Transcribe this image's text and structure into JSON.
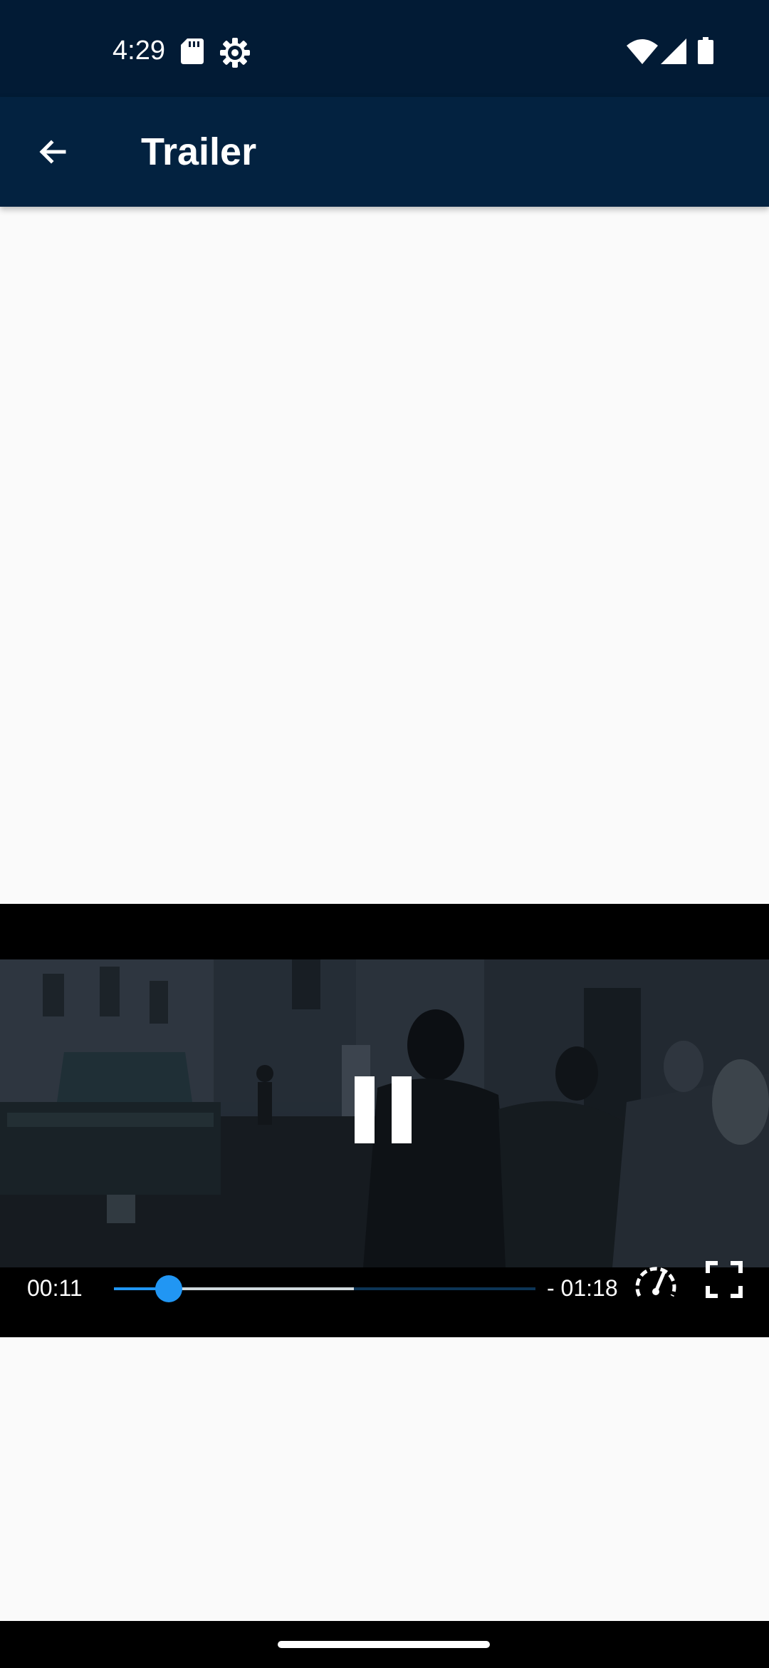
{
  "status_bar": {
    "time": "4:29",
    "icons": [
      "sd-card-icon",
      "settings-gear-icon",
      "wifi-icon",
      "cell-signal-icon",
      "battery-icon"
    ]
  },
  "app_bar": {
    "title": "Trailer",
    "back_icon": "arrow-left-icon",
    "background": "#032240"
  },
  "player": {
    "state": "playing",
    "control_icon": "pause-icon",
    "elapsed": "00:11",
    "remaining": "- 01:18",
    "progress": 0.13,
    "buffered": 0.57,
    "accent": "#2196f3",
    "speed_icon": "playback-speed-icon",
    "fullscreen_icon": "fullscreen-icon"
  },
  "colors": {
    "status_bar": "#021b35",
    "page_background": "#fafafa"
  }
}
